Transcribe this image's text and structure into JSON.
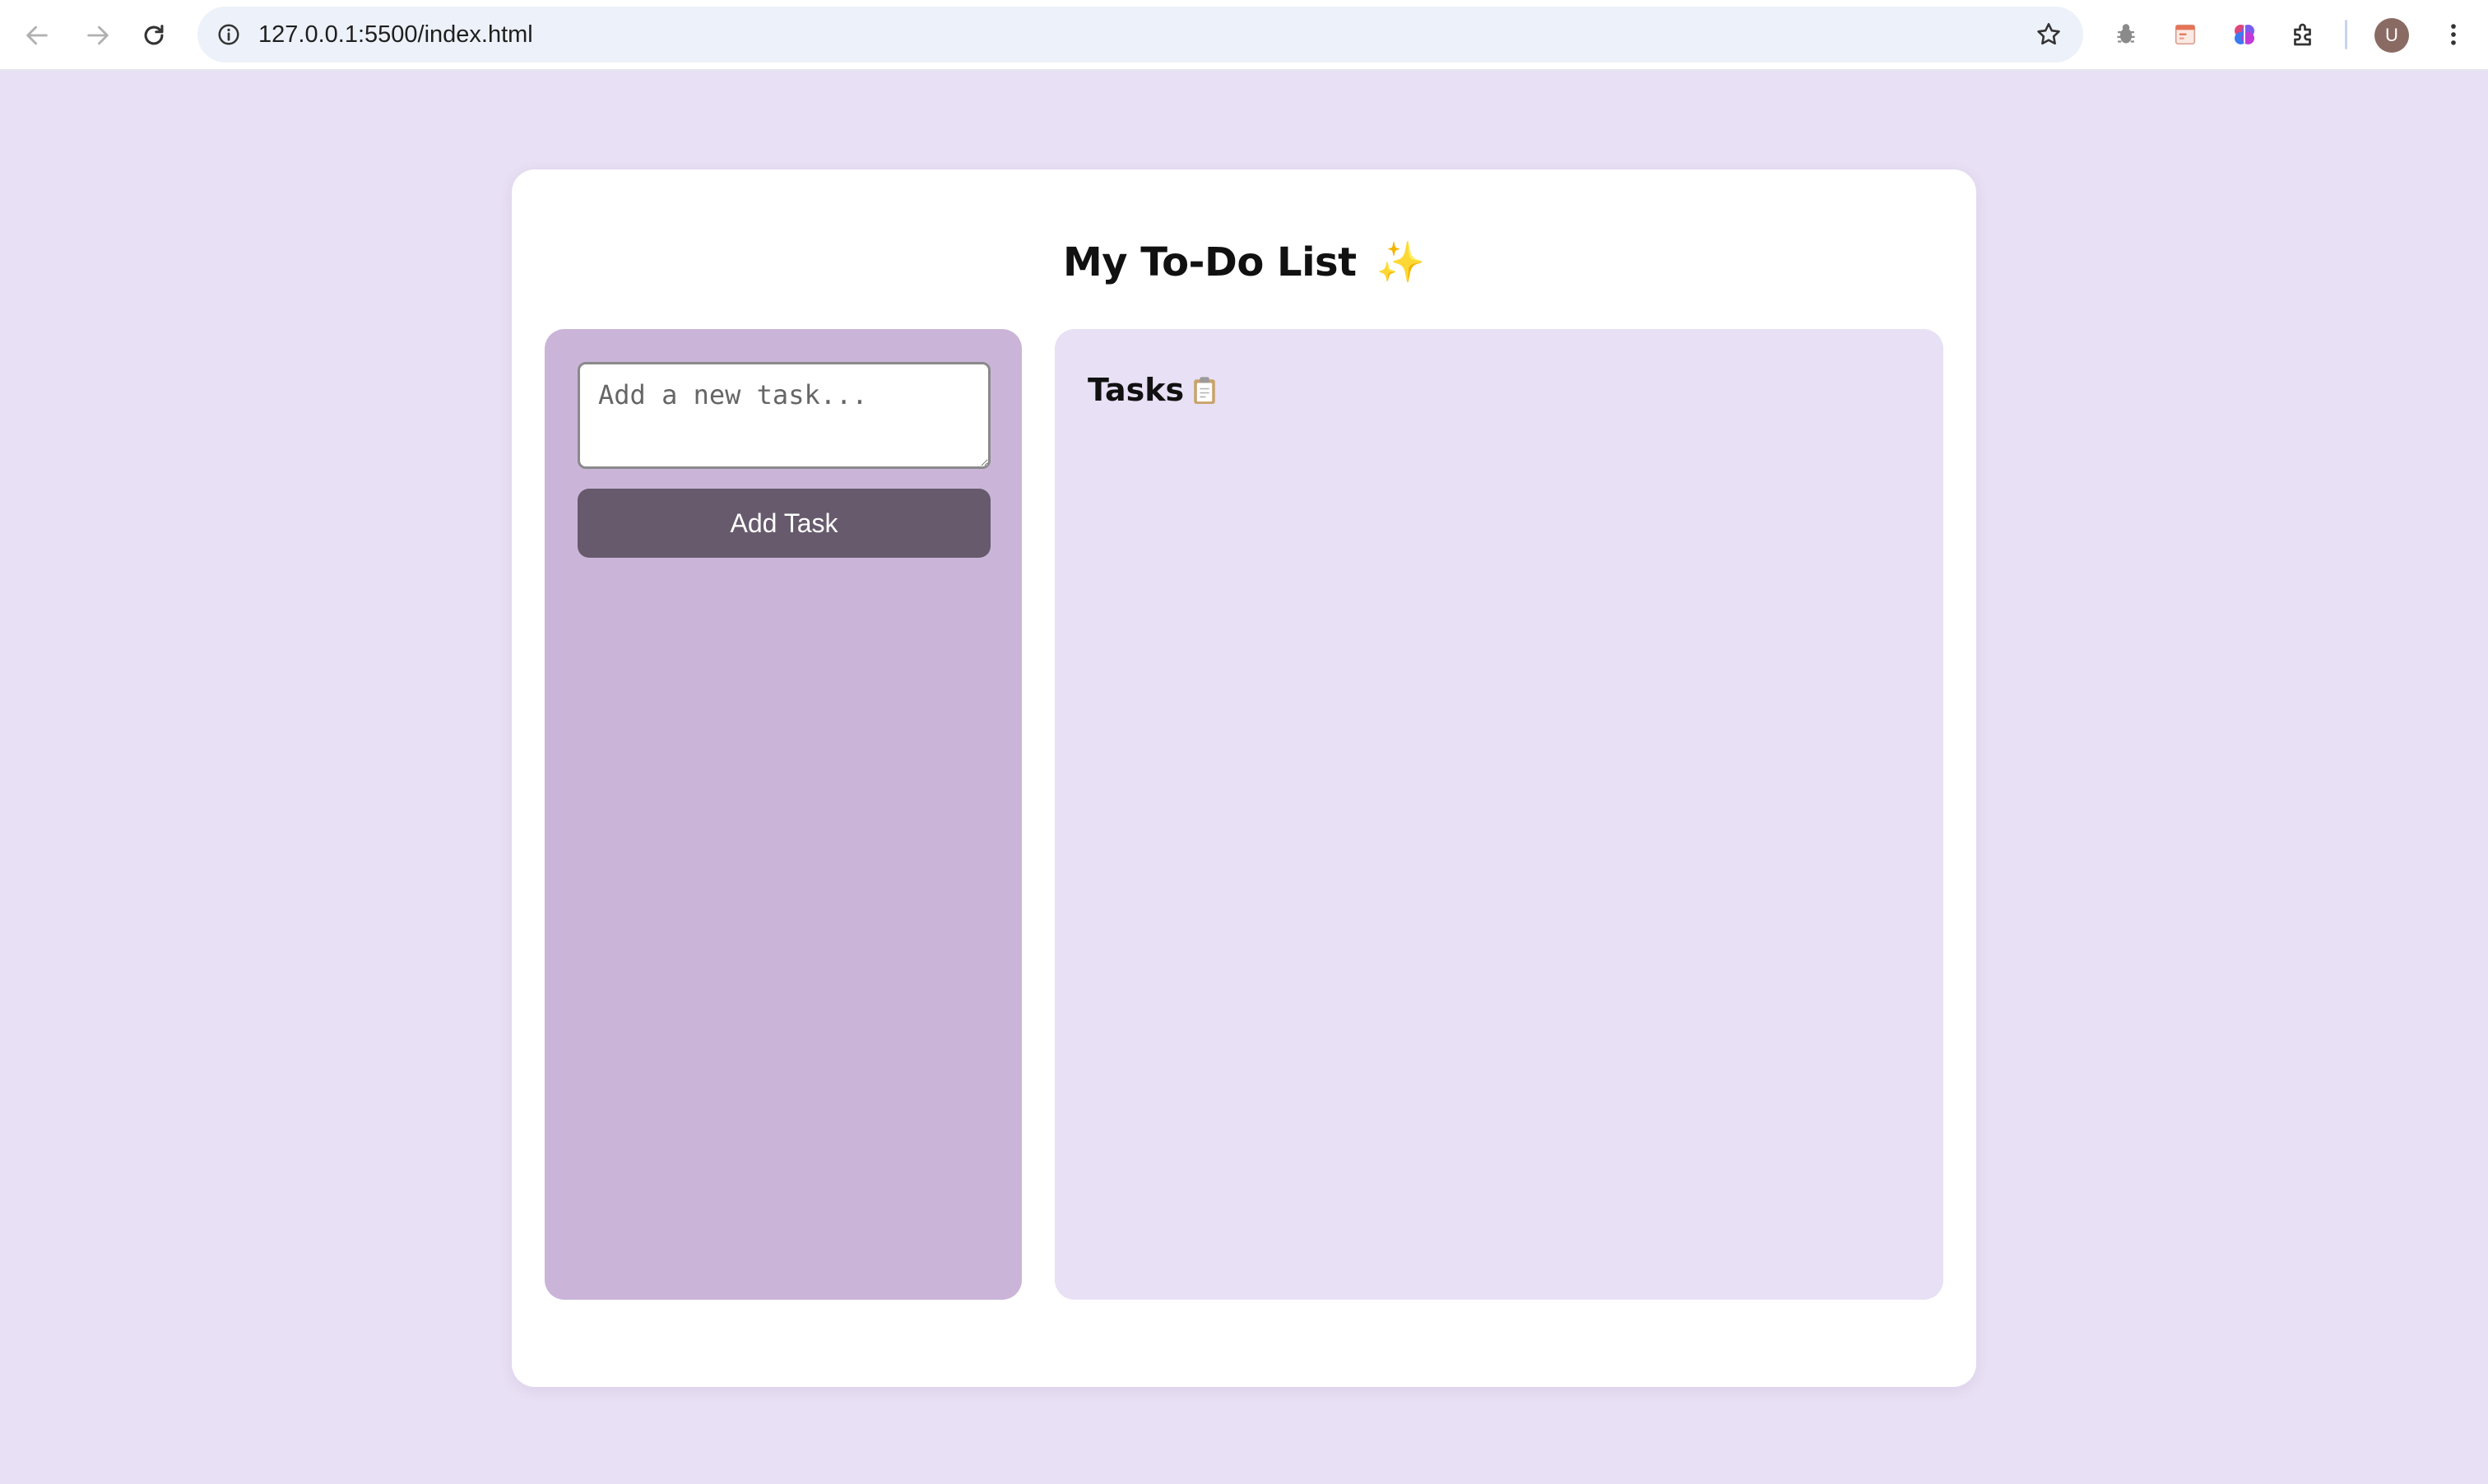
{
  "browser": {
    "url": "127.0.0.1:5500/index.html",
    "profile_initial": "U",
    "icons": [
      "back-arrow-icon",
      "forward-arrow-icon",
      "reload-icon",
      "site-info-icon",
      "bookmark-star-icon",
      "bug-extension-icon",
      "calendar-extension-icon",
      "brain-extension-icon",
      "puzzle-extensions-icon",
      "kebab-menu-icon"
    ]
  },
  "app": {
    "title": "My To-Do List",
    "title_emoji": "✨",
    "input_placeholder": "Add a new task...",
    "add_button_label": "Add Task",
    "tasks_heading": "Tasks",
    "tasks": []
  },
  "colors": {
    "page_bg": "#e8e0f4",
    "card_bg": "#ffffff",
    "left_panel_bg": "#cab5d9",
    "right_panel_bg": "#e8e0f4",
    "button_bg": "#665a6c",
    "button_text": "#ffffff"
  }
}
